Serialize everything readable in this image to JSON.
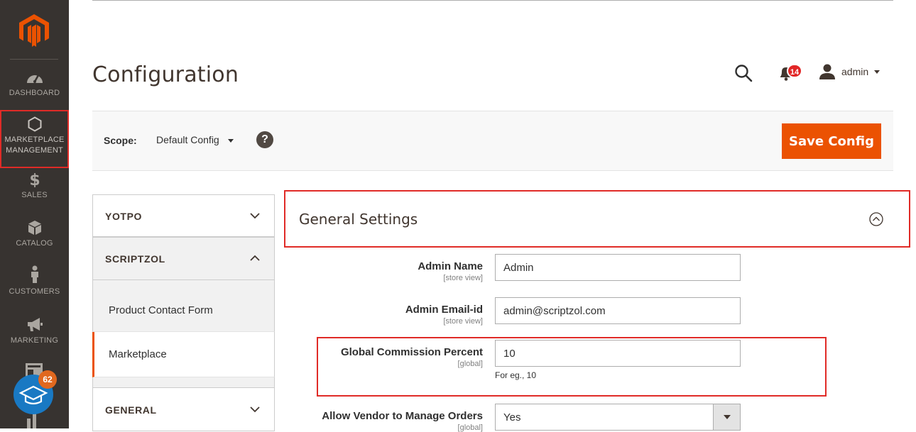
{
  "sidebar": {
    "items": [
      {
        "label": "DASHBOARD",
        "icon": "dashboard-icon"
      },
      {
        "label": "MARKETPLACE MANAGEMENT",
        "icon": "hexagon-icon"
      },
      {
        "label": "SALES",
        "icon": "dollar-icon"
      },
      {
        "label": "CATALOG",
        "icon": "box-icon"
      },
      {
        "label": "CUSTOMERS",
        "icon": "person-icon"
      },
      {
        "label": "MARKETING",
        "icon": "megaphone-icon"
      }
    ],
    "help_count": "62"
  },
  "header": {
    "title": "Configuration",
    "notifications_count": "14",
    "user_name": "admin"
  },
  "scope": {
    "label": "Scope:",
    "value": "Default Config",
    "help": "?"
  },
  "toolbar": {
    "save_label": "Save Config"
  },
  "tabs": {
    "groups": [
      {
        "label": "YOTPO"
      },
      {
        "label": "SCRIPTZOL"
      },
      {
        "label": "GENERAL"
      }
    ],
    "items": [
      {
        "label": "Product Contact Form"
      },
      {
        "label": "Marketplace"
      }
    ]
  },
  "section": {
    "title": "General Settings",
    "fields": [
      {
        "label": "Admin Name",
        "scope": "[store view]",
        "value": "Admin"
      },
      {
        "label": "Admin Email-id",
        "scope": "[store view]",
        "value": "admin@scriptzol.com"
      },
      {
        "label": "Global Commission Percent",
        "scope": "[global]",
        "value": "10",
        "note": "For eg., 10"
      },
      {
        "label": "Allow Vendor to Manage Orders",
        "scope": "[global]",
        "value": "Yes"
      }
    ]
  },
  "colors": {
    "accent": "#eb5202",
    "sidebar": "#373330",
    "highlight": "#e02b27"
  }
}
